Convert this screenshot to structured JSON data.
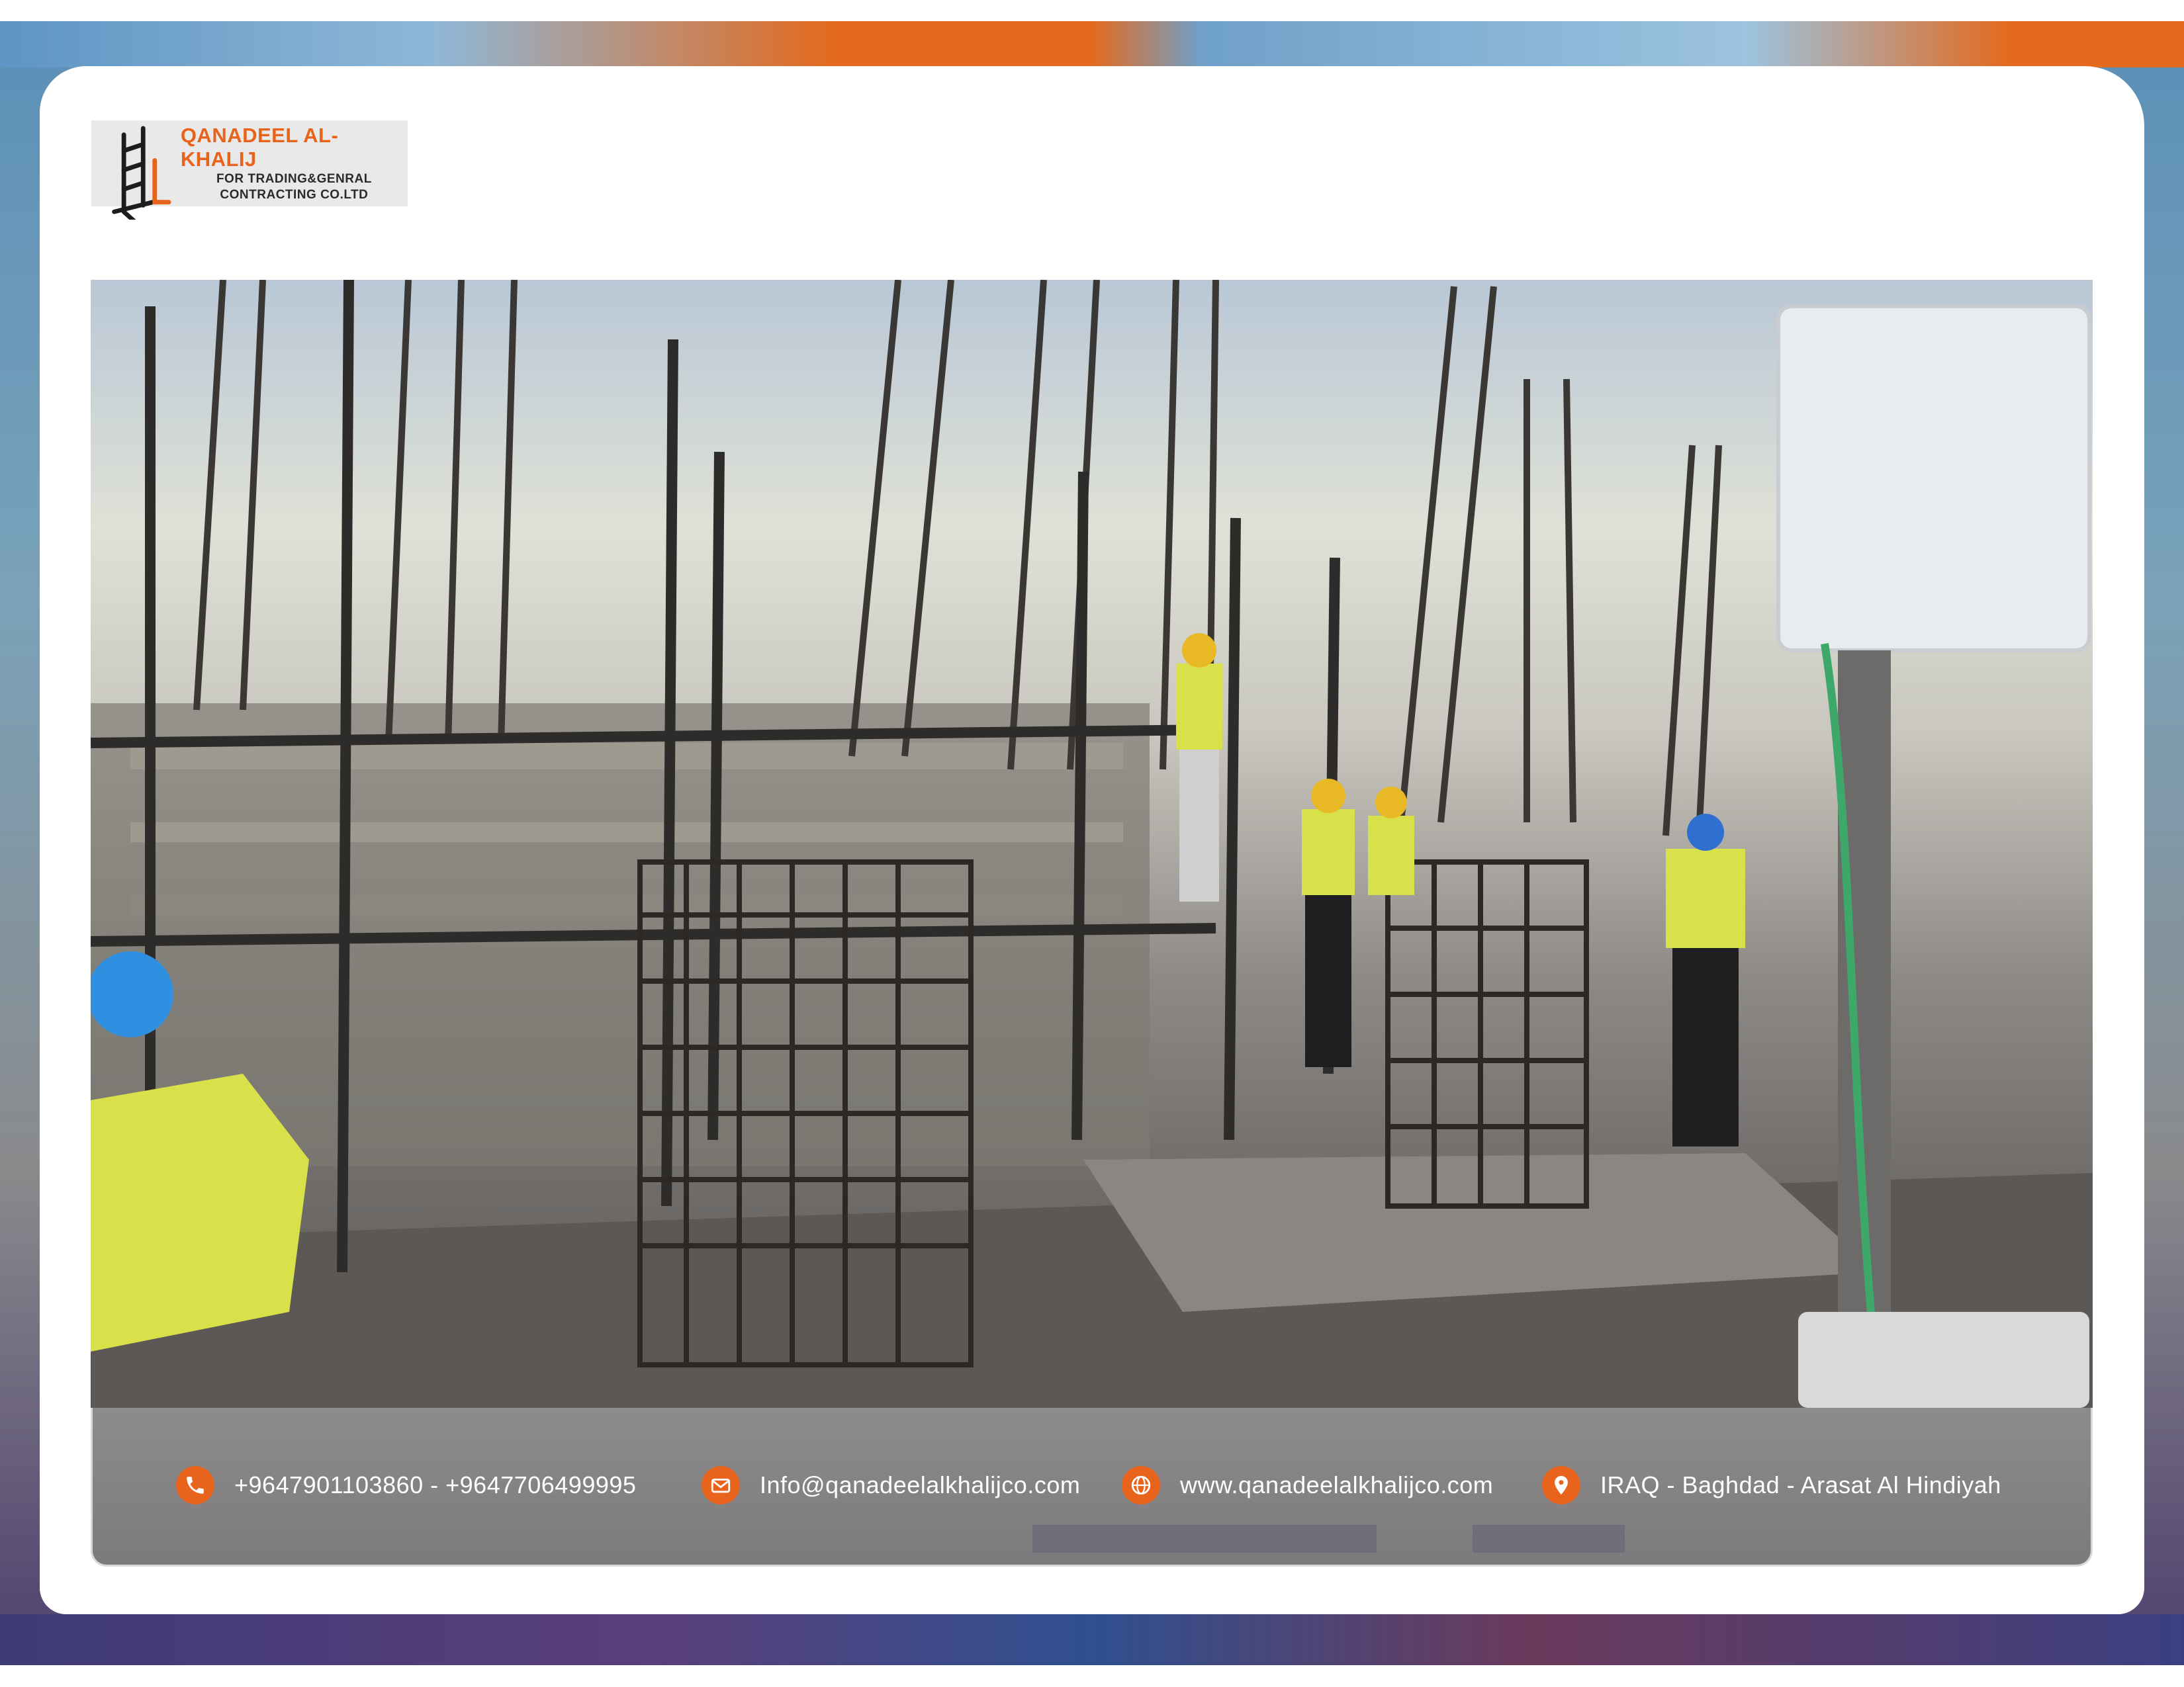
{
  "brand": {
    "name": "QANADEEL AL-KHALIJ",
    "subtitle_line1": "FOR TRADING&GENRAL",
    "subtitle_line2": "CONTRACTING CO.LTD",
    "accent_color": "#e8641c"
  },
  "photo": {
    "subject": "construction-site-rebar-columns"
  },
  "contact": {
    "phone": "+9647901103860  -  +9647706499995",
    "email": "Info@qanadeelalkhalijco.com",
    "website": "www.qanadeelalkhalijco.com",
    "address": "IRAQ - Baghdad - Arasat Al Hindiyah",
    "icons": [
      "phone-icon",
      "mail-icon",
      "globe-icon",
      "location-pin-icon"
    ]
  }
}
